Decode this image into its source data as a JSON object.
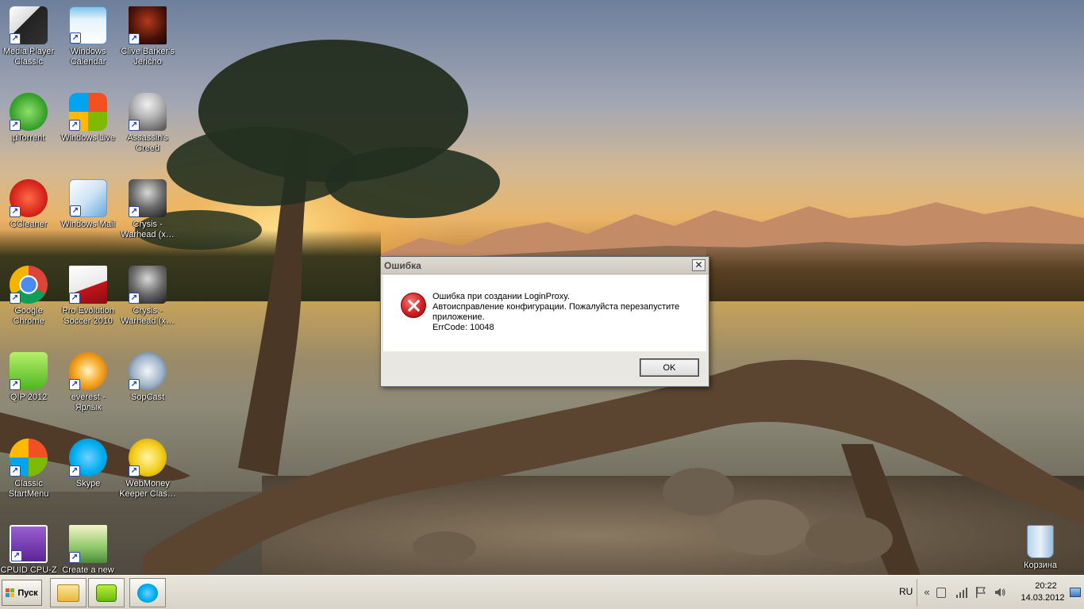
{
  "desktop": {
    "icons": [
      {
        "label": "Media Player Classic",
        "icon": "film-clapper-icon"
      },
      {
        "label": "Windows Calendar",
        "icon": "calendar-icon"
      },
      {
        "label": "Clive Barker's Jericho",
        "icon": "game-cover-icon"
      },
      {
        "label": "µTorrent",
        "icon": "utorrent-icon"
      },
      {
        "label": "Windows Live",
        "icon": "windows-flag-icon"
      },
      {
        "label": "Assassin's Creed",
        "icon": "hooded-figure-icon"
      },
      {
        "label": "CCleaner",
        "icon": "ccleaner-icon"
      },
      {
        "label": "Windows Mail",
        "icon": "mail-icon"
      },
      {
        "label": "Crysis - Warhead (x…",
        "icon": "soldier-icon"
      },
      {
        "label": "Google Chrome",
        "icon": "chrome-icon"
      },
      {
        "label": "Pro Evolution Soccer 2010",
        "icon": "pes-cover-icon"
      },
      {
        "label": "Crysis - Warhead (x…",
        "icon": "soldier-icon"
      },
      {
        "label": "QIP 2012",
        "icon": "qip-icon"
      },
      {
        "label": "everest - Ярлык",
        "icon": "everest-info-icon"
      },
      {
        "label": "SopCast",
        "icon": "sopcast-icon"
      },
      {
        "label": "Classic StartMenu",
        "icon": "windows-shell-icon"
      },
      {
        "label": "Skype",
        "icon": "skype-icon"
      },
      {
        "label": "WebMoney Keeper Clas…",
        "icon": "webmoney-icon"
      },
      {
        "label": "CPUID CPU-Z",
        "icon": "cpuz-icon"
      },
      {
        "label": "Create a new",
        "icon": "new-shortcut-icon"
      },
      {
        "label": "Корзина",
        "icon": "recycle-bin-icon"
      }
    ]
  },
  "dialog": {
    "title": "Ошибка",
    "close_glyph": "✕",
    "message_lines": [
      "Ошибка при создании LoginProxy.",
      "Автоисправление конфигурации. Пожалуйста перезапустите",
      "приложение.",
      "ErrCode: 10048"
    ],
    "ok_label": "OK"
  },
  "taskbar": {
    "start_label": "Пуск",
    "pinned": [
      {
        "name": "explorer-folder-icon"
      },
      {
        "name": "miranda-icon"
      },
      {
        "name": "skype-icon"
      }
    ],
    "language": "RU",
    "tray_chevron": "«",
    "clock_time": "20:22",
    "clock_date": "14.03.2012"
  }
}
